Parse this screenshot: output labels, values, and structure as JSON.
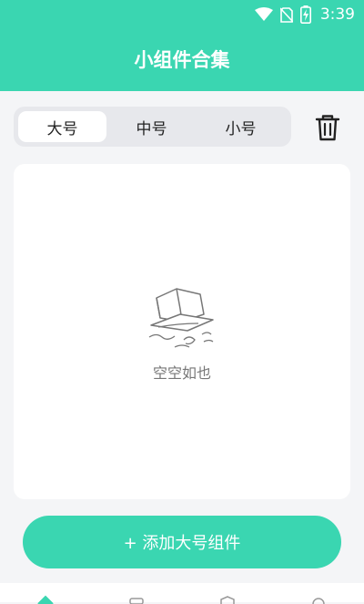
{
  "status_bar": {
    "time": "3:39",
    "icons": [
      "wifi-icon",
      "no-sim-icon",
      "battery-charging-icon"
    ]
  },
  "header": {
    "title": "小组件合集"
  },
  "size_tabs": {
    "items": [
      "大号",
      "中号",
      "小号"
    ],
    "selected": "大号"
  },
  "toolbar": {
    "delete_icon": "trash-icon"
  },
  "empty_state": {
    "icon": "empty-box-icon",
    "text": "空空如也"
  },
  "add_button": {
    "label": "+ 添加大号组件"
  },
  "bottom_nav": {
    "icons": [
      "home-icon",
      "widget-icon",
      "shield-icon",
      "profile-icon"
    ]
  },
  "colors": {
    "accent": "#3ad6b1",
    "background": "#f4f5f7",
    "card": "#ffffff"
  }
}
